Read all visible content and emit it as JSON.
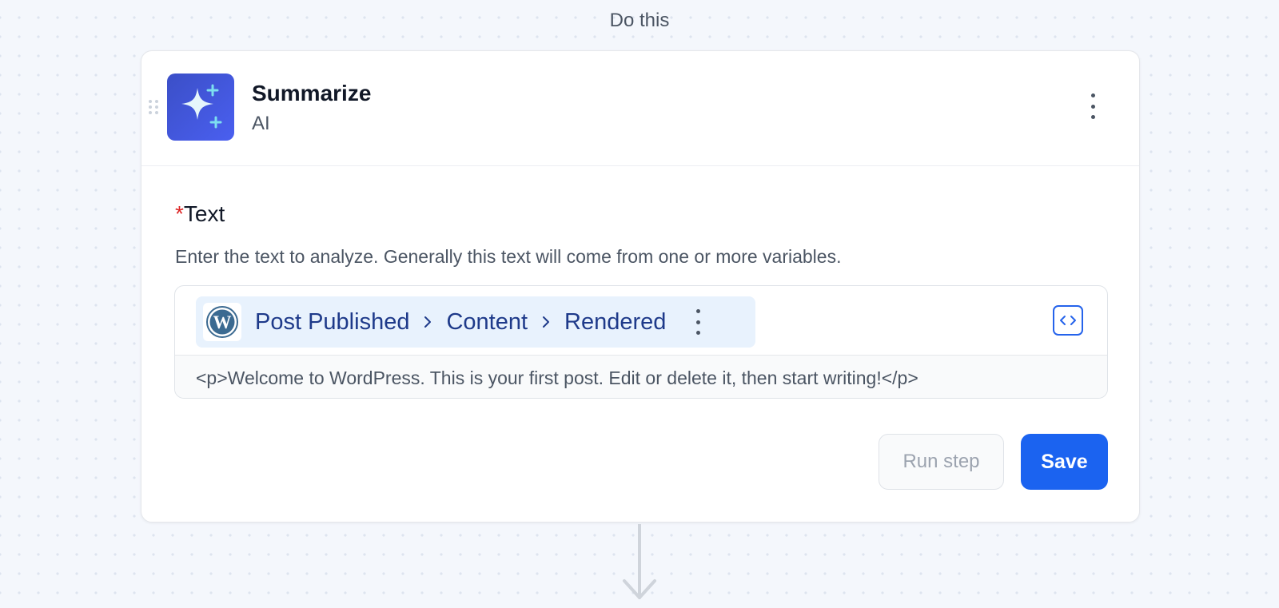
{
  "section_title": "Do this",
  "step": {
    "title": "Summarize",
    "app": "AI",
    "icon": "sparkle-icon"
  },
  "field": {
    "label": "Text",
    "required_marker": "*",
    "help": "Enter the text to analyze. Generally this text will come from one or more variables.",
    "token": {
      "app_icon": "wordpress-icon",
      "path": [
        "Post Published",
        "Content",
        "Rendered"
      ],
      "separator_icon": "chevron-right-icon"
    },
    "preview": "<p>Welcome to WordPress. This is your first post. Edit or delete it, then start writing!</p>"
  },
  "actions": {
    "run_label": "Run step",
    "save_label": "Save"
  },
  "colors": {
    "primary": "#1b63f0",
    "icon_gradient_start": "#3b4fc7",
    "icon_gradient_end": "#4a5ff0",
    "token_background": "#e8f2fd",
    "token_text": "#1e3a8a",
    "required": "#dc2626"
  }
}
